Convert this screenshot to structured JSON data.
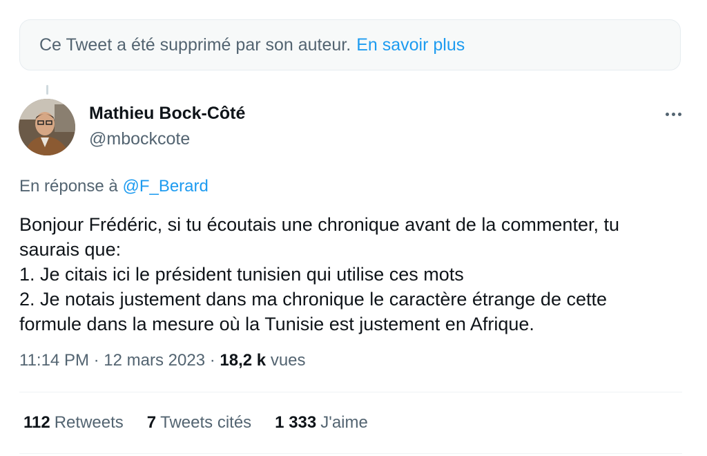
{
  "deleted_notice": {
    "text": "Ce Tweet a été supprimé par son auteur.",
    "link": "En savoir plus"
  },
  "author": {
    "name": "Mathieu Bock-Côté",
    "handle": "@mbockcote"
  },
  "reply": {
    "prefix": "En réponse à",
    "mention": "@F_Berard"
  },
  "tweet": {
    "lines": [
      "Bonjour Frédéric, si tu écoutais une chronique avant de la commenter, tu",
      "saurais que:",
      "1. Je citais ici le président tunisien qui utilise ces mots",
      "2. Je notais justement dans ma chronique le caractère étrange de cette",
      "formule dans la mesure où la Tunisie est justement en Afrique."
    ]
  },
  "meta": {
    "time": "11:14 PM",
    "separator": "·",
    "date": "12 mars 2023",
    "views_count": "18,2 k",
    "views_label": "vues"
  },
  "stats": {
    "retweets_count": "112",
    "retweets_label": "Retweets",
    "quotes_count": "7",
    "quotes_label": "Tweets cités",
    "likes_count": "1 333",
    "likes_label": "J'aime"
  },
  "colors": {
    "link": "#1d9bf0",
    "secondary_text": "#536471",
    "primary_text": "#0f1419"
  },
  "icons": [
    "more-horizontal-icon"
  ]
}
